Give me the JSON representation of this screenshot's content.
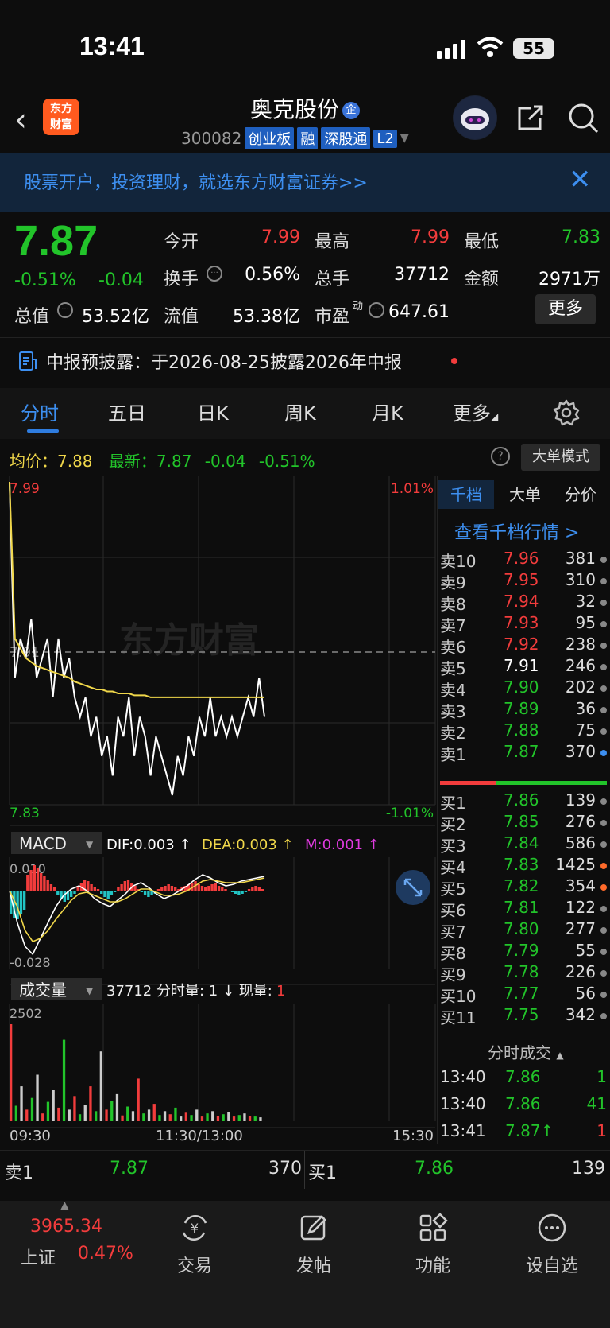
{
  "status": {
    "time": "13:41",
    "battery": "55"
  },
  "nav": {
    "logo_line1": "东方",
    "logo_line2": "财富",
    "stock_name": "奥克股份",
    "qi_badge": "企",
    "code": "300082",
    "tags": [
      "创业板",
      "融",
      "深股通",
      "L2"
    ]
  },
  "banner": {
    "text": "股票开户，投资理财，就选东方财富证券>>",
    "close": "✕"
  },
  "quote": {
    "price": "7.87",
    "pct": "-0.51%",
    "chg": "-0.04",
    "total_value_label": "总值",
    "total_value": "53.52亿",
    "open_label": "今开",
    "open": "7.99",
    "high_label": "最高",
    "high": "7.99",
    "low_label": "最低",
    "low": "7.83",
    "turnover_label": "换手",
    "turnover": "0.56%",
    "volume_label": "总手",
    "volume": "37712",
    "amount_label": "金额",
    "amount": "2971万",
    "float_label": "流值",
    "float": "53.38亿",
    "pe_label": "市盈",
    "pe_sup": "动",
    "pe": "647.61",
    "more_label": "更多"
  },
  "report": {
    "text": "中报预披露：于2026-08-25披露2026年中报"
  },
  "tabs": [
    "分时",
    "五日",
    "日K",
    "周K",
    "月K",
    "更多"
  ],
  "avg_row": {
    "avg_label": "均价：",
    "avg": "7.88",
    "latest_label": "最新：",
    "latest": "7.87",
    "chg": "-0.04",
    "pct": "-0.51%",
    "bigorder": "大单模式",
    "help": "?"
  },
  "chart": {
    "price_top": "7.99",
    "price_bottom": "7.83",
    "pct_top": "1.01%",
    "pct_bottom": "-1.01%",
    "ref_label": "7.91",
    "watermark": "东方财富",
    "macd_label": "MACD",
    "dif": "DIF:0.003 ↑",
    "dea": "DEA:0.003 ↑",
    "m": "M:0.001 ↑",
    "macd_top": "0.010",
    "macd_bottom": "-0.028",
    "vol_label": "成交量",
    "vol_info": "37712 分时量: 1 ↓ 现量: ",
    "vol_now": "1",
    "vol_top": "2502",
    "time_start": "09:30",
    "time_mid": "11:30/13:00",
    "time_end": "15:30"
  },
  "chart_data": {
    "type": "line",
    "title": "",
    "x": [
      "09:30",
      "11:30/13:00",
      "15:30"
    ],
    "ylim": [
      7.83,
      7.99
    ],
    "prev_close": 7.91,
    "series": [
      {
        "name": "最新",
        "color": "#ffffff",
        "values": [
          7.99,
          7.89,
          7.91,
          7.9,
          7.92,
          7.89,
          7.9,
          7.91,
          7.88,
          7.91,
          7.89,
          7.9,
          7.88,
          7.87,
          7.88,
          7.86,
          7.87,
          7.85,
          7.86,
          7.84,
          7.87,
          7.86,
          7.88,
          7.85,
          7.87,
          7.86,
          7.84,
          7.86,
          7.85,
          7.84,
          7.83,
          7.85,
          7.84,
          7.86,
          7.85,
          7.87,
          7.86,
          7.88,
          7.86,
          7.87,
          7.86,
          7.87,
          7.86,
          7.87,
          7.88,
          7.87,
          7.89,
          7.87
        ]
      },
      {
        "name": "均价",
        "color": "#f0d74a",
        "values": [
          7.99,
          7.91,
          7.905,
          7.9,
          7.898,
          7.896,
          7.895,
          7.894,
          7.893,
          7.892,
          7.891,
          7.89,
          7.888,
          7.887,
          7.886,
          7.885,
          7.884,
          7.884,
          7.883,
          7.883,
          7.882,
          7.882,
          7.882,
          7.881,
          7.881,
          7.881,
          7.88,
          7.88,
          7.88,
          7.88,
          7.88,
          7.88,
          7.88,
          7.88,
          7.88,
          7.88,
          7.88,
          7.88,
          7.88,
          7.88,
          7.88,
          7.88,
          7.88,
          7.88,
          7.88,
          7.88,
          7.88,
          7.88
        ]
      }
    ],
    "macd": {
      "ylim": [
        -0.028,
        0.01
      ],
      "dif": 0.003,
      "dea": 0.003,
      "m": 0.001
    },
    "volume": {
      "ymax": 2502,
      "values": [
        2502,
        400,
        900,
        300,
        600,
        1200,
        200,
        500,
        800,
        350,
        2100,
        300,
        650,
        180,
        420,
        900,
        260,
        1800,
        300,
        520,
        700,
        150,
        380,
        260,
        1100,
        200,
        300,
        450,
        160,
        260,
        180,
        350,
        120,
        220,
        160,
        300,
        120,
        200,
        260,
        140,
        180,
        240,
        120,
        160,
        200,
        140,
        120,
        100
      ]
    }
  },
  "right_panel": {
    "tabs": [
      "千档",
      "大单",
      "分价"
    ],
    "link": "查看千档行情 >",
    "asks": [
      {
        "label": "卖10",
        "price": "7.96",
        "vol": "381",
        "color": "red"
      },
      {
        "label": "卖9",
        "price": "7.95",
        "vol": "310",
        "color": "red"
      },
      {
        "label": "卖8",
        "price": "7.94",
        "vol": "32",
        "color": "red"
      },
      {
        "label": "卖7",
        "price": "7.93",
        "vol": "95",
        "color": "red"
      },
      {
        "label": "卖6",
        "price": "7.92",
        "vol": "238",
        "color": "red"
      },
      {
        "label": "卖5",
        "price": "7.91",
        "vol": "246",
        "color": "white"
      },
      {
        "label": "卖4",
        "price": "7.90",
        "vol": "202",
        "color": "green"
      },
      {
        "label": "卖3",
        "price": "7.89",
        "vol": "36",
        "color": "green"
      },
      {
        "label": "卖2",
        "price": "7.88",
        "vol": "75",
        "color": "green"
      },
      {
        "label": "卖1",
        "price": "7.87",
        "vol": "370",
        "color": "green"
      }
    ],
    "bids": [
      {
        "label": "买1",
        "price": "7.86",
        "vol": "139",
        "color": "green"
      },
      {
        "label": "买2",
        "price": "7.85",
        "vol": "276",
        "color": "green"
      },
      {
        "label": "买3",
        "price": "7.84",
        "vol": "586",
        "color": "green"
      },
      {
        "label": "买4",
        "price": "7.83",
        "vol": "1425",
        "color": "green"
      },
      {
        "label": "买5",
        "price": "7.82",
        "vol": "354",
        "color": "green"
      },
      {
        "label": "买6",
        "price": "7.81",
        "vol": "122",
        "color": "green"
      },
      {
        "label": "买7",
        "price": "7.80",
        "vol": "277",
        "color": "green"
      },
      {
        "label": "买8",
        "price": "7.79",
        "vol": "55",
        "color": "green"
      },
      {
        "label": "买9",
        "price": "7.78",
        "vol": "226",
        "color": "green"
      },
      {
        "label": "买10",
        "price": "7.77",
        "vol": "56",
        "color": "green"
      },
      {
        "label": "买11",
        "price": "7.75",
        "vol": "342",
        "color": "green"
      }
    ],
    "trades_title": "分时成交",
    "trades": [
      {
        "time": "13:40",
        "price": "7.86",
        "vol": "1"
      },
      {
        "time": "13:40",
        "price": "7.86",
        "vol": "41"
      },
      {
        "time": "13:41",
        "price": "7.87↑",
        "vol": "1"
      }
    ]
  },
  "bottom_quote": {
    "sell_label": "卖1",
    "sell_price": "7.87",
    "sell_vol": "370",
    "buy_label": "买1",
    "buy_price": "7.86",
    "buy_vol": "139"
  },
  "bottom_nav": {
    "index_value": "3965.34",
    "index_name": "上证",
    "index_pct": "0.47%",
    "items": [
      "交易",
      "发帖",
      "功能",
      "设自选"
    ]
  }
}
